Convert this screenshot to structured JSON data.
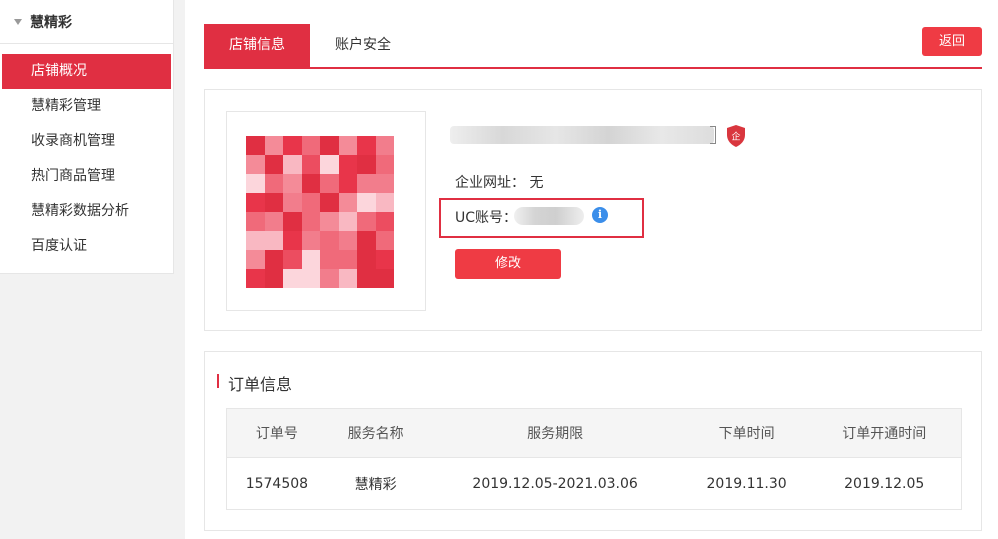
{
  "sidebar": {
    "title": "慧精彩",
    "items": [
      {
        "label": "店铺概况",
        "active": true
      },
      {
        "label": "慧精彩管理"
      },
      {
        "label": "收录商机管理"
      },
      {
        "label": "热门商品管理"
      },
      {
        "label": "慧精彩数据分析"
      },
      {
        "label": "百度认证"
      }
    ]
  },
  "tabs": [
    {
      "label": "店铺信息",
      "active": true
    },
    {
      "label": "账户安全"
    }
  ],
  "back_label": "返回",
  "shop": {
    "badge": "企",
    "website_label": "企业网址：",
    "website_value": "无",
    "uc_label": "UC账号：",
    "info_icon": "i",
    "edit_label": "修改"
  },
  "orders": {
    "section_title": "订单信息",
    "headers": [
      "订单号",
      "服务名称",
      "服务期限",
      "下单时间",
      "订单开通时间"
    ],
    "rows": [
      [
        "1574508",
        "慧精彩",
        "2019.12.05-2021.03.06",
        "2019.11.30",
        "2019.12.05"
      ]
    ]
  },
  "colors": {
    "accent": "#e02f42",
    "button": "#ef3b44",
    "info": "#3b8eea"
  }
}
